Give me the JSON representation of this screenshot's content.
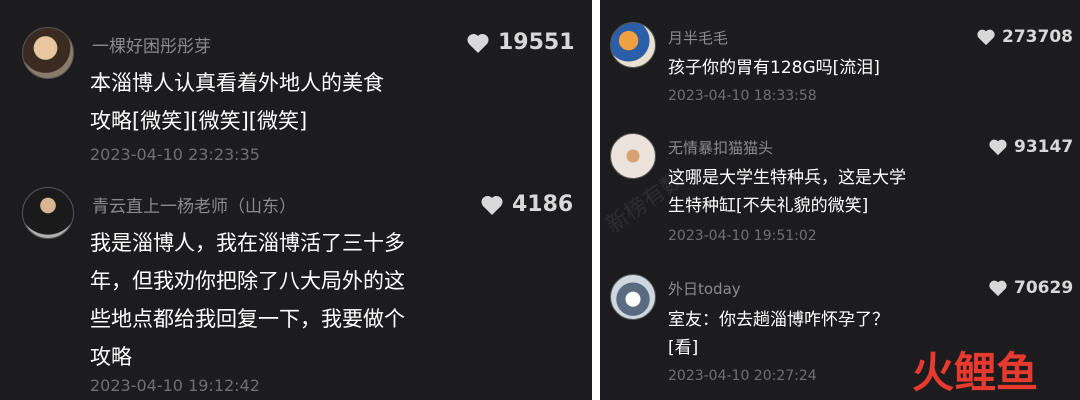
{
  "left": {
    "comments": [
      {
        "username": "一棵好困彤彤芽",
        "likes": "19551",
        "lines": [
          "本淄博人认真看着外地人的美食",
          "攻略[微笑][微笑][微笑]"
        ],
        "timestamp": "2023-04-10 23:23:35"
      },
      {
        "username": "青云直上一杨老师（山东）",
        "likes": "4186",
        "lines": [
          "我是淄博人，我在淄博活了三十多",
          "年，但我劝你把除了八大局外的这",
          "些地点都给我回复一下，我要做个",
          "攻略"
        ],
        "timestamp": "2023-04-10 19:12:42"
      }
    ]
  },
  "right": {
    "comments": [
      {
        "username": "月半毛毛",
        "likes": "273708",
        "lines": [
          "孩子你的胃有128G吗[流泪]"
        ],
        "timestamp": "2023-04-10 18:33:58"
      },
      {
        "username": "无情暴扣猫猫头",
        "likes": "93147",
        "lines": [
          "这哪是大学生特种兵，这是大学",
          "生特种缸[不失礼貌的微笑]"
        ],
        "timestamp": "2023-04-10 19:51:02"
      },
      {
        "username": "外日today",
        "likes": "70629",
        "lines": [
          "室友：你去趟淄博咋怀孕了？",
          "[看]"
        ],
        "timestamp": "2023-04-10 20:27:24"
      }
    ]
  },
  "watermark_text": "新榜有数",
  "brand": {
    "name": "火鲤鱼",
    "colors": [
      "#e8392f",
      "#f0543c",
      "#e8392f"
    ]
  },
  "icons": {
    "like": "heart-icon"
  }
}
